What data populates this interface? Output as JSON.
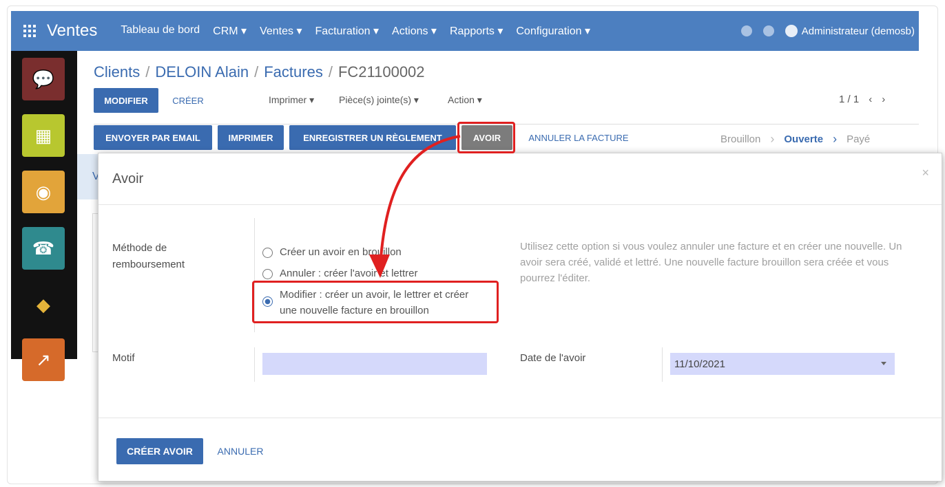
{
  "topbar": {
    "app_name": "Ventes",
    "menu": [
      "Tableau de bord",
      "CRM ▾",
      "Ventes ▾",
      "Facturation ▾",
      "Actions ▾",
      "Rapports ▾",
      "Configuration ▾"
    ],
    "user": "Administrateur (demosb)",
    "color": "#4c7fc0"
  },
  "breadcrumb": {
    "items": [
      "Clients",
      "DELOIN Alain",
      "Factures"
    ],
    "current": "FC21100002"
  },
  "controls": {
    "edit": "MODIFIER",
    "create": "CRÉER",
    "print": "Imprimer ▾",
    "attachments": "Pièce(s) jointe(s) ▾",
    "action": "Action ▾",
    "pager": "1 / 1"
  },
  "status_buttons": {
    "email": "ENVOYER PAR EMAIL",
    "print": "IMPRIMER",
    "payment": "ENREGISTRER UN RÈGLEMENT",
    "refund": "AVOIR",
    "cancel": "ANNULER LA FACTURE"
  },
  "status_steps": [
    "Brouillon",
    "Ouverte",
    "Payé"
  ],
  "status_active": "Ouverte",
  "bg_hint": "V",
  "modal": {
    "title": "Avoir",
    "close": "×",
    "method_label": "Méthode de remboursement",
    "options": [
      {
        "label": "Créer un avoir en brouillon",
        "selected": false
      },
      {
        "label": "Annuler : créer l'avoir et lettrer",
        "selected": false
      },
      {
        "label": "Modifier : créer un avoir, le lettrer et créer une nouvelle facture en brouillon",
        "selected": true
      }
    ],
    "help": "Utilisez cette option si vous voulez annuler une facture et en créer une nouvelle. Un avoir sera créé, validé et lettré. Une nouvelle facture brouillon sera créée et vous pourrez l'éditer.",
    "motif_label": "Motif",
    "motif_value": "",
    "date_label": "Date de l'avoir",
    "date_value": "11/10/2021",
    "create_button": "CRÉER AVOIR",
    "cancel_button": "ANNULER"
  },
  "annotation_color": "#e02020"
}
